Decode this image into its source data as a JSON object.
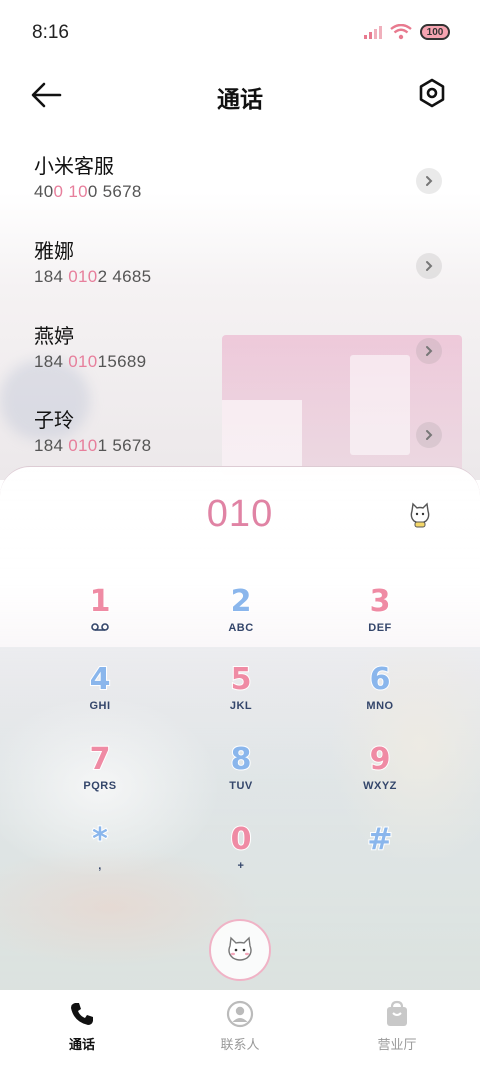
{
  "status_bar": {
    "time": "8:16",
    "battery": "100"
  },
  "header": {
    "title": "通话"
  },
  "contacts": [
    {
      "name": "小米客服",
      "number_parts": [
        "40",
        "0",
        " ",
        "10",
        "0 5678"
      ],
      "highlight": [
        false,
        true,
        false,
        true,
        false
      ]
    },
    {
      "name": "雅娜",
      "number_parts": [
        "184 ",
        "010",
        "2 4685"
      ],
      "highlight": [
        false,
        true,
        false
      ]
    },
    {
      "name": "燕婷",
      "number_parts": [
        "184 ",
        "010",
        "15689"
      ],
      "highlight": [
        false,
        true,
        false
      ]
    },
    {
      "name": "子玲",
      "number_parts": [
        "184 ",
        "010",
        "1 5678"
      ],
      "highlight": [
        false,
        true,
        false
      ]
    }
  ],
  "dial_pad": {
    "input": "010",
    "keys": [
      {
        "digit": "1",
        "letters": "voicemail",
        "color": "pink"
      },
      {
        "digit": "2",
        "letters": "ABC",
        "color": "blue"
      },
      {
        "digit": "3",
        "letters": "DEF",
        "color": "pink"
      },
      {
        "digit": "4",
        "letters": "GHI",
        "color": "blue"
      },
      {
        "digit": "5",
        "letters": "JKL",
        "color": "pink"
      },
      {
        "digit": "6",
        "letters": "MNO",
        "color": "blue"
      },
      {
        "digit": "7",
        "letters": "PQRS",
        "color": "pink"
      },
      {
        "digit": "8",
        "letters": "TUV",
        "color": "blue"
      },
      {
        "digit": "9",
        "letters": "WXYZ",
        "color": "pink"
      },
      {
        "digit": "*",
        "letters": ",",
        "color": "blue"
      },
      {
        "digit": "0",
        "letters": "+",
        "color": "pink"
      },
      {
        "digit": "#",
        "letters": "",
        "color": "blue"
      }
    ]
  },
  "bottom_nav": [
    {
      "label": "通话",
      "icon": "phone-icon",
      "active": true
    },
    {
      "label": "联系人",
      "icon": "person-icon",
      "active": false
    },
    {
      "label": "营业厅",
      "icon": "shopping-bag-icon",
      "active": false
    }
  ],
  "colors": {
    "accent_pink": "#e083a4",
    "key_pink": "#ef8ba4",
    "key_blue": "#8ab6ec",
    "letters": "#34466b"
  }
}
